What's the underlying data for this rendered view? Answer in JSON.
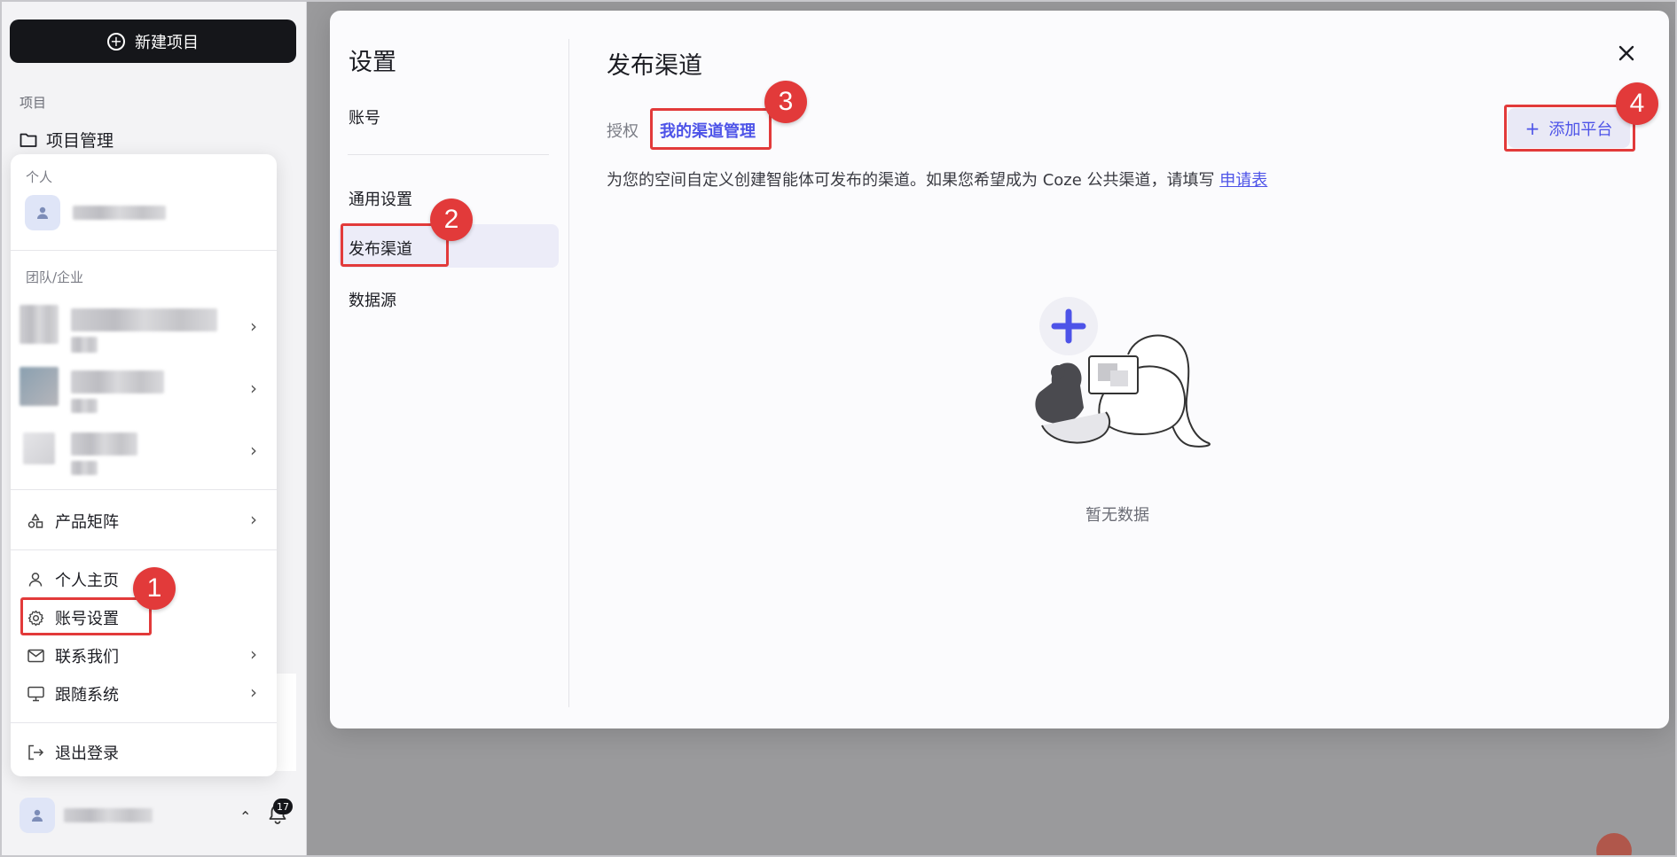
{
  "sidebar": {
    "new_project_label": "新建项目",
    "section_label": "项目",
    "project_mgmt_label": "项目管理",
    "notification_count": "17"
  },
  "popup": {
    "personal_label": "个人",
    "team_label": "团队/企业",
    "product_matrix": "产品矩阵",
    "profile": "个人主页",
    "account_settings": "账号设置",
    "contact_us": "联系我们",
    "follow_system": "跟随系统",
    "logout": "退出登录"
  },
  "settings": {
    "title": "设置",
    "nav": {
      "account": "账号",
      "general": "通用设置",
      "publish_channels": "发布渠道",
      "data_sources": "数据源"
    }
  },
  "content": {
    "title": "发布渠道",
    "tab_auth": "授权",
    "tab_my_channels": "我的渠道管理",
    "add_platform": "添加平台",
    "add_platform_icon": "+",
    "description": "为您的空间自定义创建智能体可发布的渠道。如果您希望成为 Coze 公共渠道，请填写",
    "apply_link": "申请表",
    "empty_text": "暂无数据"
  },
  "annotations": [
    "1",
    "2",
    "3",
    "4"
  ],
  "colors": {
    "accent": "#4d53e8",
    "highlight": "#e23a3a",
    "dark_button": "#15161a"
  }
}
